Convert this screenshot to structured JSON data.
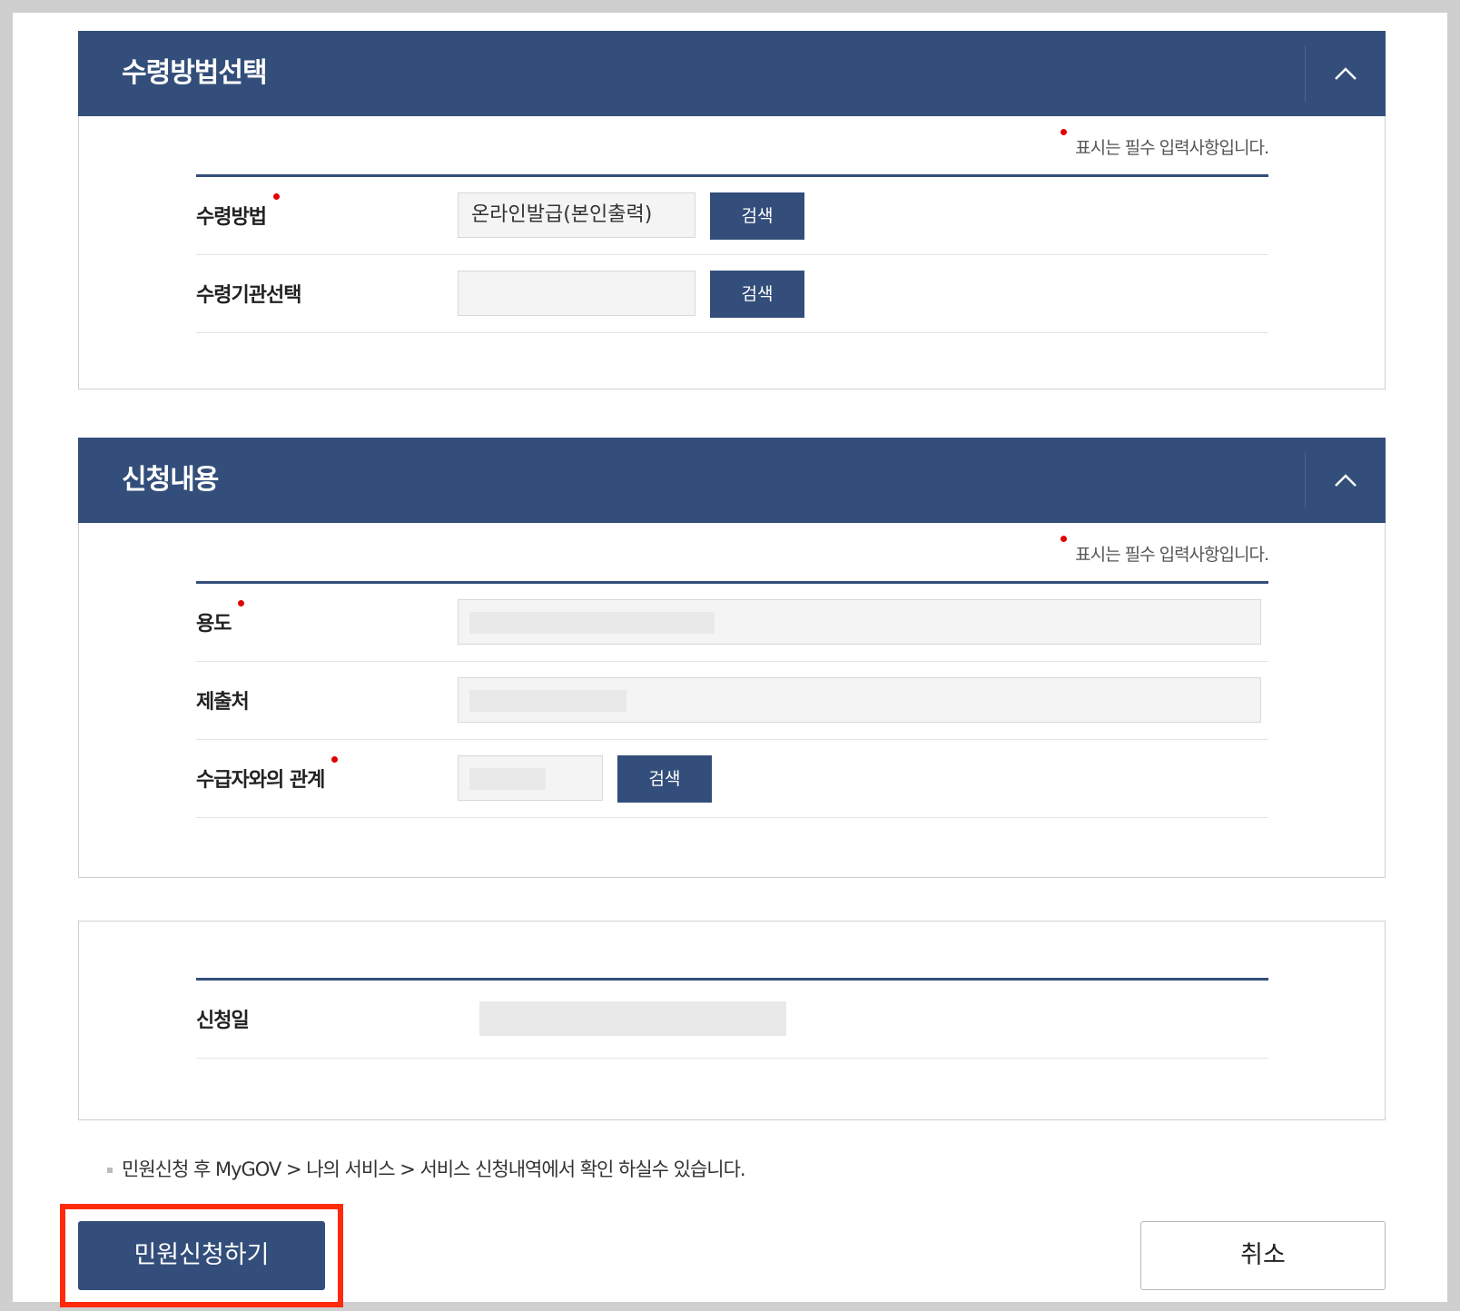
{
  "sections": {
    "receipt": {
      "title": "수령방법선택",
      "required_note": "표시는 필수 입력사항입니다.",
      "rows": [
        {
          "label": "수령방법",
          "value": "온라인발급(본인출력)",
          "button": "검색"
        },
        {
          "label": "수령기관선택",
          "value": "",
          "button": "검색"
        }
      ]
    },
    "application": {
      "title": "신청내용",
      "required_note": "표시는 필수 입력사항입니다.",
      "rows": [
        {
          "label": "용도",
          "value": ""
        },
        {
          "label": "제출처",
          "value": ""
        },
        {
          "label": "수급자와의 관계",
          "value": "",
          "button": "검색"
        }
      ]
    },
    "date": {
      "rows": [
        {
          "label": "신청일",
          "value": ""
        }
      ]
    }
  },
  "notice": "민원신청 후 MyGOV > 나의 서비스 > 서비스 신청내역에서 확인 하실수 있습니다.",
  "actions": {
    "submit_label": "민원신청하기",
    "cancel_label": "취소"
  },
  "colors": {
    "primary": "#334e7a",
    "required_dot": "#e00000",
    "highlight": "#ff2a0a"
  },
  "icons": {
    "collapse": "chevron-up-icon",
    "required": "required-dot-icon"
  }
}
